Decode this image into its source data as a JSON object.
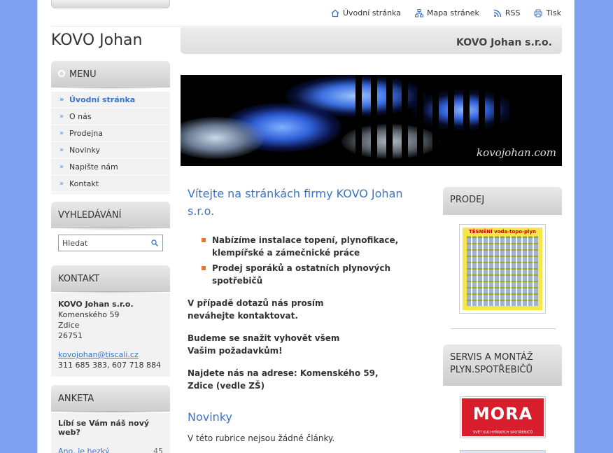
{
  "toplinks": {
    "home": "Úvodní stránka",
    "sitemap": "Mapa stránek",
    "rss": "RSS",
    "print": "Tisk"
  },
  "site_title": "KOVO Johan",
  "header_company": "KOVO Johan s.r.o.",
  "banner_watermark": "kovojohan.com",
  "menu": {
    "title": "MENU",
    "items": [
      {
        "label": "Úvodní stránka",
        "active": true
      },
      {
        "label": "O nás",
        "active": false
      },
      {
        "label": "Prodejna",
        "active": false
      },
      {
        "label": "Novinky",
        "active": false
      },
      {
        "label": "Napište nám",
        "active": false
      },
      {
        "label": "Kontakt",
        "active": false
      }
    ]
  },
  "search": {
    "title": "VYHLEDÁVÁNÍ",
    "value": "Hledat"
  },
  "contact": {
    "title": "KONTAKT",
    "company": "KOVO Johan s.r.o.",
    "street": "Komenského 59",
    "city": "Zdice",
    "zip": "26751",
    "email": "kovojohan@tiscali.cz",
    "phones": "311 685 383, 607 718 884"
  },
  "poll": {
    "title": "ANKETA",
    "question": "Líbí se Vám náš nový web?",
    "answer": "Ano, je hezký",
    "count": "45",
    "fraction": 0.45
  },
  "main": {
    "heading": "Vítejte na stránkách firmy KOVO Johan s.r.o.",
    "bullets": [
      "Nabízíme instalace topení, plynofikace, klempířské a zámečnické práce",
      "Prodej sporáků a ostatních plynových spotřebičů"
    ],
    "p1": "V případě dotazů nás prosím neváhejte kontaktovat.",
    "p2": "Budeme se snažit vyhovět všem Vašim požadavkům!",
    "p3": "Najdete nás na adrese: Komenského 59, Zdice (vedle ZŠ)",
    "news_heading": "Novinky",
    "news_empty": "V této rubrice nejsou žádné články."
  },
  "right": {
    "prodej_title": "PRODEJ",
    "prodej_image_title": "TĚSNĚNÍ voda-topo-plyn",
    "servis_title": "SERVIS A MONTÁŽ PLYN.SPOTŘEBIČŮ",
    "mora_logo": "MORA",
    "mora_sub": "SVĚT KUCHYŇSKÝCH SPOTŘEBIČŮ"
  },
  "colors": {
    "background": "#7f9ff0",
    "accent": "#3a73c9",
    "bullet": "#e8742a"
  }
}
